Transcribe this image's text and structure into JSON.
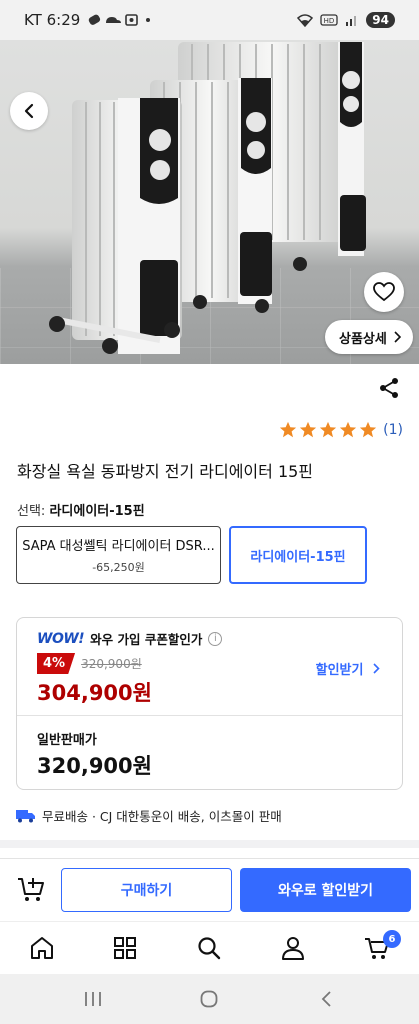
{
  "status_bar": {
    "carrier_time": "KT 6:29",
    "battery": "94"
  },
  "hero": {
    "detail_label": "상품상세"
  },
  "rating": {
    "stars": 5,
    "count": "(1)"
  },
  "product": {
    "title": "화장실 욕실 동파방지 전기 라디에이터 15핀"
  },
  "selection": {
    "prefix": "선택: ",
    "selected": "라디에이터-15핀",
    "options": [
      {
        "name": "SAPA 대성쎌틱 라디에이터 DSR...",
        "price_diff": "-65,250원"
      },
      {
        "name": "라디에이터-15핀"
      }
    ]
  },
  "pricing": {
    "wow_logo": "WOW!",
    "wow_label": "와우 가입 쿠폰할인가",
    "discount": "4%",
    "original_price": "320,900원",
    "sale_price": "304,900원",
    "coupon_link": "할인받기",
    "normal_label": "일반판매가",
    "normal_price": "320,900원"
  },
  "shipping": {
    "text": "무료배송 · CJ 대한통운이 배송, 이츠몰이 판매"
  },
  "actions": {
    "buy": "구매하기",
    "wow_buy": "와우로 할인받기"
  },
  "nav": {
    "cart_count": "6"
  },
  "colors": {
    "accent": "#346aff",
    "sale_red": "#ae0000",
    "badge_red": "#ca0b0b",
    "star": "#f08a24"
  }
}
